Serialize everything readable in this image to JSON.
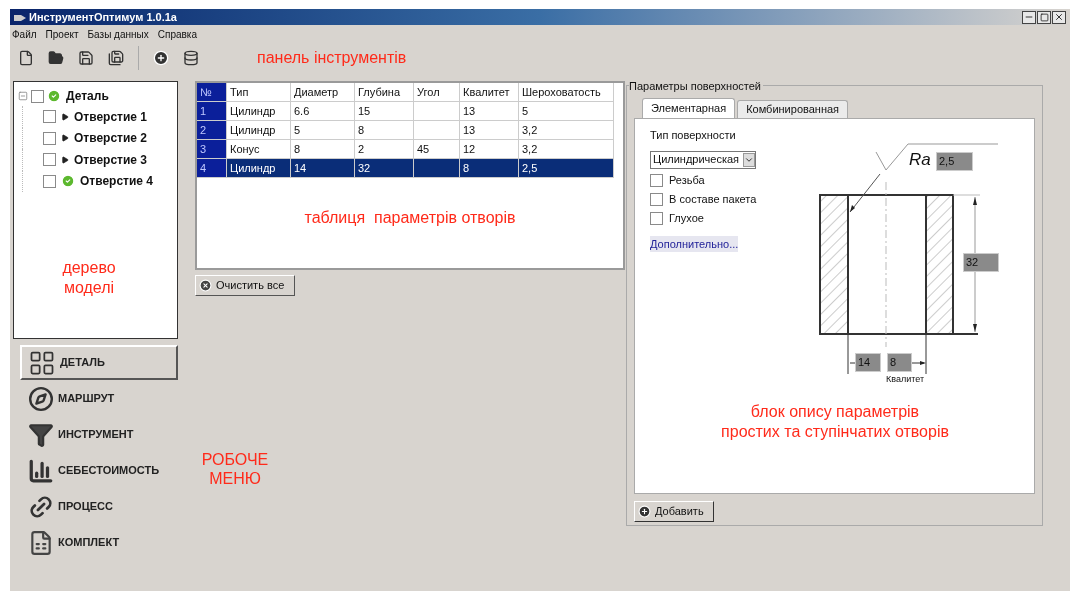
{
  "window": {
    "title": "ИнструментОптимум 1.0.1a"
  },
  "menu": [
    "Файл",
    "Проект",
    "Базы данных",
    "Справка"
  ],
  "toolbar_note": "панель інструментів",
  "tree": {
    "label": "Деталь",
    "checked": false,
    "expanded": true,
    "kind": "done",
    "children": [
      {
        "label": "Отверстие 1",
        "checked": false,
        "kind": "group"
      },
      {
        "label": "Отверстие 2",
        "checked": false,
        "kind": "group"
      },
      {
        "label": "Отверстие 3",
        "checked": false,
        "kind": "group"
      },
      {
        "label": "Отверстие 4",
        "checked": false,
        "kind": "done"
      }
    ]
  },
  "tree_note": [
    "дерево",
    "моделі"
  ],
  "table": {
    "columns": [
      "№",
      "Тип",
      "Диаметр",
      "Глубина",
      "Угол",
      "Квалитет",
      "Шероховатость"
    ],
    "rows": [
      {
        "cells": [
          "1",
          "Цилиндр",
          "6.6",
          "15",
          "",
          "13",
          "5"
        ],
        "selected": false
      },
      {
        "cells": [
          "2",
          "Цилиндр",
          "5",
          "8",
          "",
          "13",
          "3,2"
        ],
        "selected": false
      },
      {
        "cells": [
          "3",
          "Конус",
          "8",
          "2",
          "45",
          "12",
          "3,2"
        ],
        "selected": false
      },
      {
        "cells": [
          "4",
          "Цилиндр",
          "14",
          "32",
          "",
          "8",
          "2,5"
        ],
        "selected": true
      }
    ]
  },
  "table_note": "таблиця  параметрів отворів",
  "clear_button": "Очистить все",
  "nav": [
    {
      "label": "ДЕТАЛЬ",
      "selected": true
    },
    {
      "label": "МАРШРУТ",
      "selected": false
    },
    {
      "label": "ИНСТРУМЕНТ",
      "selected": false
    },
    {
      "label": "СЕБЕСТОИМОСТЬ",
      "selected": false
    },
    {
      "label": "ПРОЦЕСС",
      "selected": false
    },
    {
      "label": "КОМПЛЕКТ",
      "selected": false
    }
  ],
  "nav_note": [
    "РОБОЧЕ",
    "МЕНЮ"
  ],
  "surface": {
    "group_title": "Параметры поверхностей",
    "tabs": [
      {
        "label": "Элементарная",
        "selected": true
      },
      {
        "label": "Комбинированная",
        "selected": false
      }
    ],
    "type_label": "Тип поверхности",
    "type_value": "Цилиндрическая",
    "options": [
      {
        "label": "Резьба",
        "checked": false
      },
      {
        "label": "В составе пакета",
        "checked": false
      },
      {
        "label": "Глухое",
        "checked": false
      }
    ],
    "more_link": "Дополнительно...",
    "drawing": {
      "ra_label": "Ra",
      "roughness": "2,5",
      "depth": "32",
      "diameter": "14",
      "quality": "8",
      "quality_label": "Квалитет"
    },
    "note": [
      "блок опису параметрів",
      "простих та ступінчатих отворів"
    ],
    "add_button": "Добавить"
  }
}
